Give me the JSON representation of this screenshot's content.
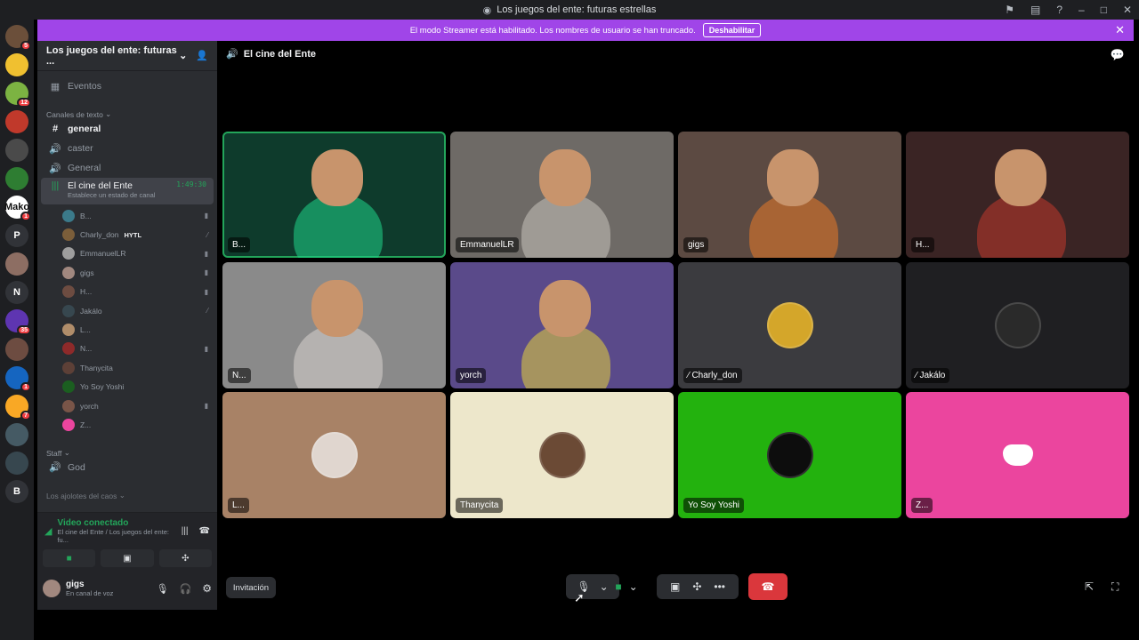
{
  "window": {
    "title": "Los juegos del ente: futuras estrellas"
  },
  "banner": {
    "text": "El modo Streamer está habilitado. Los nombres de usuario se han truncado.",
    "button": "Deshabilitar"
  },
  "servers": [
    {
      "label": "",
      "color": "#6b4f3a",
      "badge": "5"
    },
    {
      "label": "",
      "color": "#f0c030",
      "badge": ""
    },
    {
      "label": "",
      "color": "#7cb342",
      "badge": "12"
    },
    {
      "label": "",
      "color": "#c0392b",
      "badge": ""
    },
    {
      "label": "",
      "color": "#4a4a4a",
      "badge": ""
    },
    {
      "label": "",
      "color": "#2e7d32",
      "badge": ""
    },
    {
      "label": "Mako",
      "color": "#ffffff",
      "badge": "1"
    },
    {
      "label": "P",
      "color": "#313338",
      "badge": ""
    },
    {
      "label": "",
      "color": "#8d6e63",
      "badge": ""
    },
    {
      "label": "N",
      "color": "#313338",
      "badge": ""
    },
    {
      "label": "",
      "color": "#5e35b1",
      "badge": "35"
    },
    {
      "label": "",
      "color": "#6d4c41",
      "badge": ""
    },
    {
      "label": "",
      "color": "#1565c0",
      "badge": "1"
    },
    {
      "label": "",
      "color": "#f9a825",
      "badge": "7"
    },
    {
      "label": "",
      "color": "#455a64",
      "badge": ""
    },
    {
      "label": "",
      "color": "#37474f",
      "badge": ""
    },
    {
      "label": "B",
      "color": "#313338",
      "badge": ""
    }
  ],
  "sidebar": {
    "guild_name": "Los juegos del ente: futuras ...",
    "events": "Eventos",
    "cat_text": "Canales de texto",
    "channels": [
      {
        "name": "general",
        "icon": "#"
      },
      {
        "name": "caster",
        "icon": "🔊"
      },
      {
        "name": "General",
        "icon": "🔊"
      }
    ],
    "active_voice": {
      "name": "El cine del Ente",
      "timer": "1:49:30",
      "status": "Establece un estado de canal"
    },
    "voice_users": [
      {
        "name": "B...",
        "color": "#3b7a8a",
        "cam": "▮",
        "tag": ""
      },
      {
        "name": "Charly_don",
        "color": "#7b5e3a",
        "cam": "⁄",
        "tag": "HYTL"
      },
      {
        "name": "EmmanuelLR",
        "color": "#9e9e9e",
        "cam": "▮",
        "tag": ""
      },
      {
        "name": "gigs",
        "color": "#a1887f",
        "cam": "▮",
        "tag": ""
      },
      {
        "name": "H...",
        "color": "#6d4c41",
        "cam": "▮",
        "tag": ""
      },
      {
        "name": "Jakálo",
        "color": "#37474f",
        "cam": "⁄",
        "tag": ""
      },
      {
        "name": "L...",
        "color": "#b08d6a",
        "cam": "",
        "tag": ""
      },
      {
        "name": "N...",
        "color": "#8e2a2a",
        "cam": "▮",
        "tag": ""
      },
      {
        "name": "Thanycita",
        "color": "#5d4037",
        "cam": "",
        "tag": ""
      },
      {
        "name": "Yo Soy Yoshi",
        "color": "#1b5e20",
        "cam": "",
        "tag": ""
      },
      {
        "name": "yorch",
        "color": "#795548",
        "cam": "▮",
        "tag": ""
      },
      {
        "name": "Z...",
        "color": "#eb459e",
        "cam": "",
        "tag": ""
      }
    ],
    "cat_staff": "Staff",
    "god": "God",
    "cat_cut": "Los ajolotes del caos"
  },
  "voice_panel": {
    "status": "Video conectado",
    "location": "El cine del Ente / Los juegos del ente: fu..."
  },
  "user_panel": {
    "name": "gigs",
    "status": "En canal de voz"
  },
  "main": {
    "channel": "El cine del Ente",
    "invite": "Invitación",
    "tiles": [
      {
        "name": "B...",
        "bg": "#0e3b2c",
        "type": "video",
        "accent": "#1fd58a",
        "speaking": true,
        "muted": false
      },
      {
        "name": "EmmanuelLR",
        "bg": "#6e6a66",
        "type": "video",
        "accent": "#c9c3bb",
        "speaking": false,
        "muted": false
      },
      {
        "name": "gigs",
        "bg": "#5c4a42",
        "type": "video",
        "accent": "#e87a2a",
        "speaking": false,
        "muted": false
      },
      {
        "name": "H...",
        "bg": "#3a2424",
        "type": "video",
        "accent": "#c0392b",
        "speaking": false,
        "muted": false
      },
      {
        "name": "N...",
        "bg": "#8a8a8a",
        "type": "video",
        "accent": "#d9d4cf",
        "speaking": false,
        "muted": false
      },
      {
        "name": "yorch",
        "bg": "#5a4a8a",
        "type": "video",
        "accent": "#e6d23c",
        "speaking": false,
        "muted": false
      },
      {
        "name": "Charly_don",
        "bg": "#3b3b3f",
        "type": "avatar",
        "accent": "#d4a62a",
        "speaking": false,
        "muted": true
      },
      {
        "name": "Jakálo",
        "bg": "#1f1f22",
        "type": "avatar",
        "accent": "#2a2a2a",
        "speaking": false,
        "muted": true
      },
      {
        "name": "L...",
        "bg": "#a88266",
        "type": "avatar",
        "accent": "#e0d6cf",
        "speaking": false,
        "muted": false
      },
      {
        "name": "Thanycita",
        "bg": "#ede7cb",
        "type": "avatar",
        "accent": "#6b4a35",
        "speaking": false,
        "muted": false
      },
      {
        "name": "Yo Soy Yoshi",
        "bg": "#23b20e",
        "type": "avatar",
        "accent": "#0d0d0d",
        "speaking": false,
        "muted": false
      },
      {
        "name": "Z...",
        "bg": "#eb459e",
        "type": "discord",
        "accent": "#ffffff",
        "speaking": false,
        "muted": false
      }
    ]
  },
  "colors": {
    "accent": "#a045e8",
    "hangup": "#da373c",
    "green": "#23a55a"
  }
}
